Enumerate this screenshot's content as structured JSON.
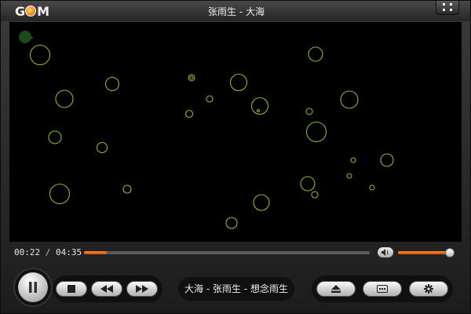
{
  "app": {
    "logo": "GOM",
    "title": "张雨生 - 大海",
    "menu_icon": "expand-icon"
  },
  "video": {
    "background": "#000000",
    "bubble_color": "#8ab82e",
    "watermark_icon": "gom-watermark-icon"
  },
  "seek": {
    "current": "00:22",
    "separator": "/",
    "total": "04:35",
    "progress": 0.08
  },
  "volume": {
    "icon": "speaker-icon",
    "level": 0.92
  },
  "controls": {
    "play_pause_icon": "pause-icon",
    "stop_icon": "stop-icon",
    "rewind_icon": "rewind-icon",
    "forward_icon": "fast-forward-icon",
    "eject_icon": "eject-icon",
    "subtitle_icon": "subtitle-icon",
    "settings_icon": "gear-icon"
  },
  "now_playing": "大海 - 张雨生 - 想念雨生",
  "colors": {
    "accent": "#ff7a1f",
    "bubble": "#8ab82e"
  }
}
